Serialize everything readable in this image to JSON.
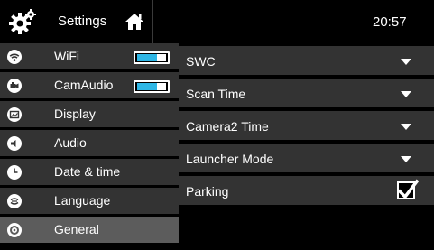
{
  "header": {
    "title": "Settings",
    "time": "20:57",
    "settings_icon": "gears-icon",
    "home_icon": "home-icon"
  },
  "sidebar": {
    "items": [
      {
        "label": "WiFi",
        "icon": "wifi-icon",
        "toggle": true,
        "toggle_on": true
      },
      {
        "label": "CamAudio",
        "icon": "camaudio-icon",
        "toggle": true,
        "toggle_on": true
      },
      {
        "label": "Display",
        "icon": "display-icon",
        "toggle": false
      },
      {
        "label": "Audio",
        "icon": "speaker-icon",
        "toggle": false
      },
      {
        "label": "Date & time",
        "icon": "clock-icon",
        "toggle": false
      },
      {
        "label": "Language",
        "icon": "language-icon",
        "toggle": false
      },
      {
        "label": "General",
        "icon": "gear-icon",
        "toggle": false,
        "selected": true
      }
    ]
  },
  "main": {
    "rows": [
      {
        "label": "SWC",
        "control": "dropdown"
      },
      {
        "label": "Scan Time",
        "control": "dropdown"
      },
      {
        "label": "Camera2 Time",
        "control": "dropdown"
      },
      {
        "label": "Launcher Mode",
        "control": "dropdown"
      },
      {
        "label": "Parking",
        "control": "checkbox",
        "checked": true
      }
    ]
  },
  "colors": {
    "toggle_accent": "#2fb7e6",
    "item_bg": "#333333",
    "selected_bg": "#5c5c5c"
  }
}
